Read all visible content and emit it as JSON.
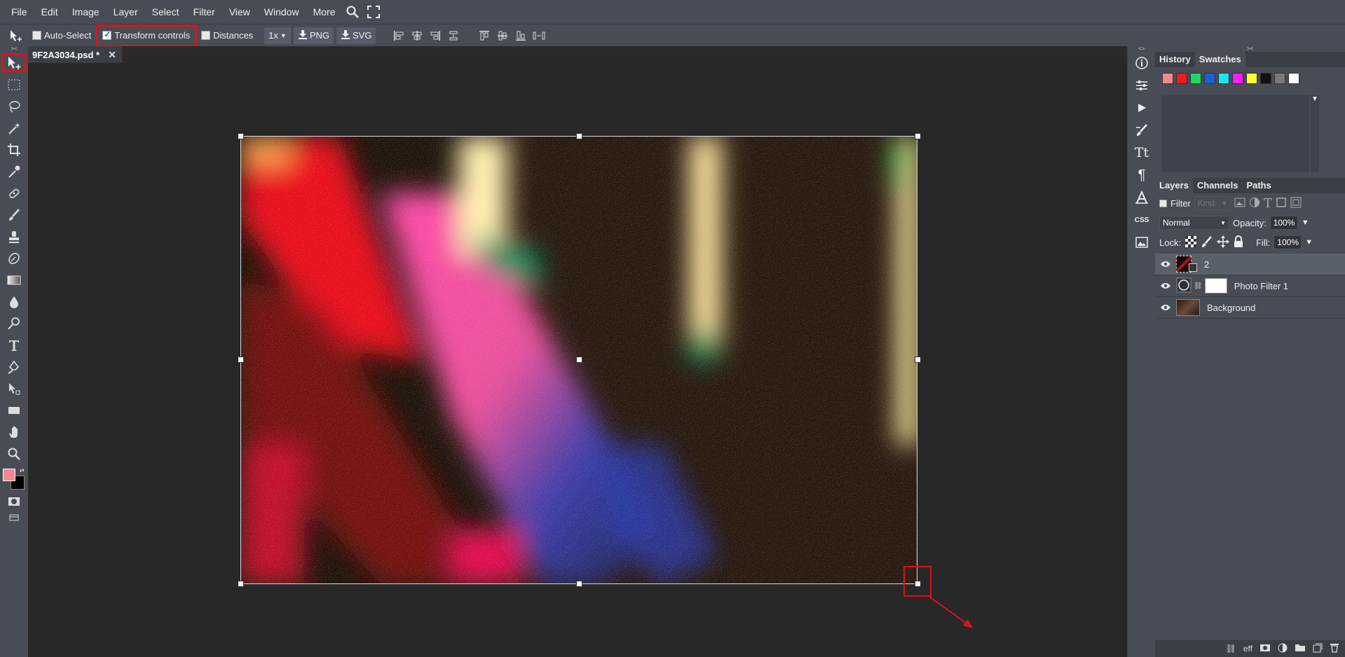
{
  "menu": [
    "File",
    "Edit",
    "Image",
    "Layer",
    "Select",
    "Filter",
    "View",
    "Window",
    "More"
  ],
  "options": {
    "auto_select": "Auto-Select",
    "transform_controls": "Transform controls",
    "distances": "Distances",
    "zoom": "1x",
    "png": "PNG",
    "svg": "SVG"
  },
  "document_tab": "9F2A3034.psd *",
  "panel_top": {
    "tabs": [
      "History",
      "Swatches"
    ],
    "swatches": [
      "#f4868e",
      "#ed1c24",
      "#1ed760",
      "#1a5fd8",
      "#1ae6f0",
      "#ff1aff",
      "#ffff33",
      "#111111",
      "#7a7a7a",
      "#ffffff"
    ]
  },
  "panel_layers": {
    "tabs": [
      "Layers",
      "Channels",
      "Paths"
    ],
    "filter_label": "Filter",
    "kind": "Kind",
    "blend": "Normal",
    "opacity_label": "Opacity:",
    "opacity": "100%",
    "lock_label": "Lock:",
    "fill_label": "Fill:",
    "fill": "100%",
    "layers": [
      {
        "name": "2"
      },
      {
        "name": "Photo Filter 1"
      },
      {
        "name": "Background"
      }
    ]
  },
  "bottom_bar": {
    "eff": "eff"
  },
  "right_strip_text": {
    "tt": "Tt",
    "css": "CSS"
  },
  "colors": {
    "foreground": "#f4868e",
    "background": "#000000",
    "highlight": "#d8141c"
  }
}
